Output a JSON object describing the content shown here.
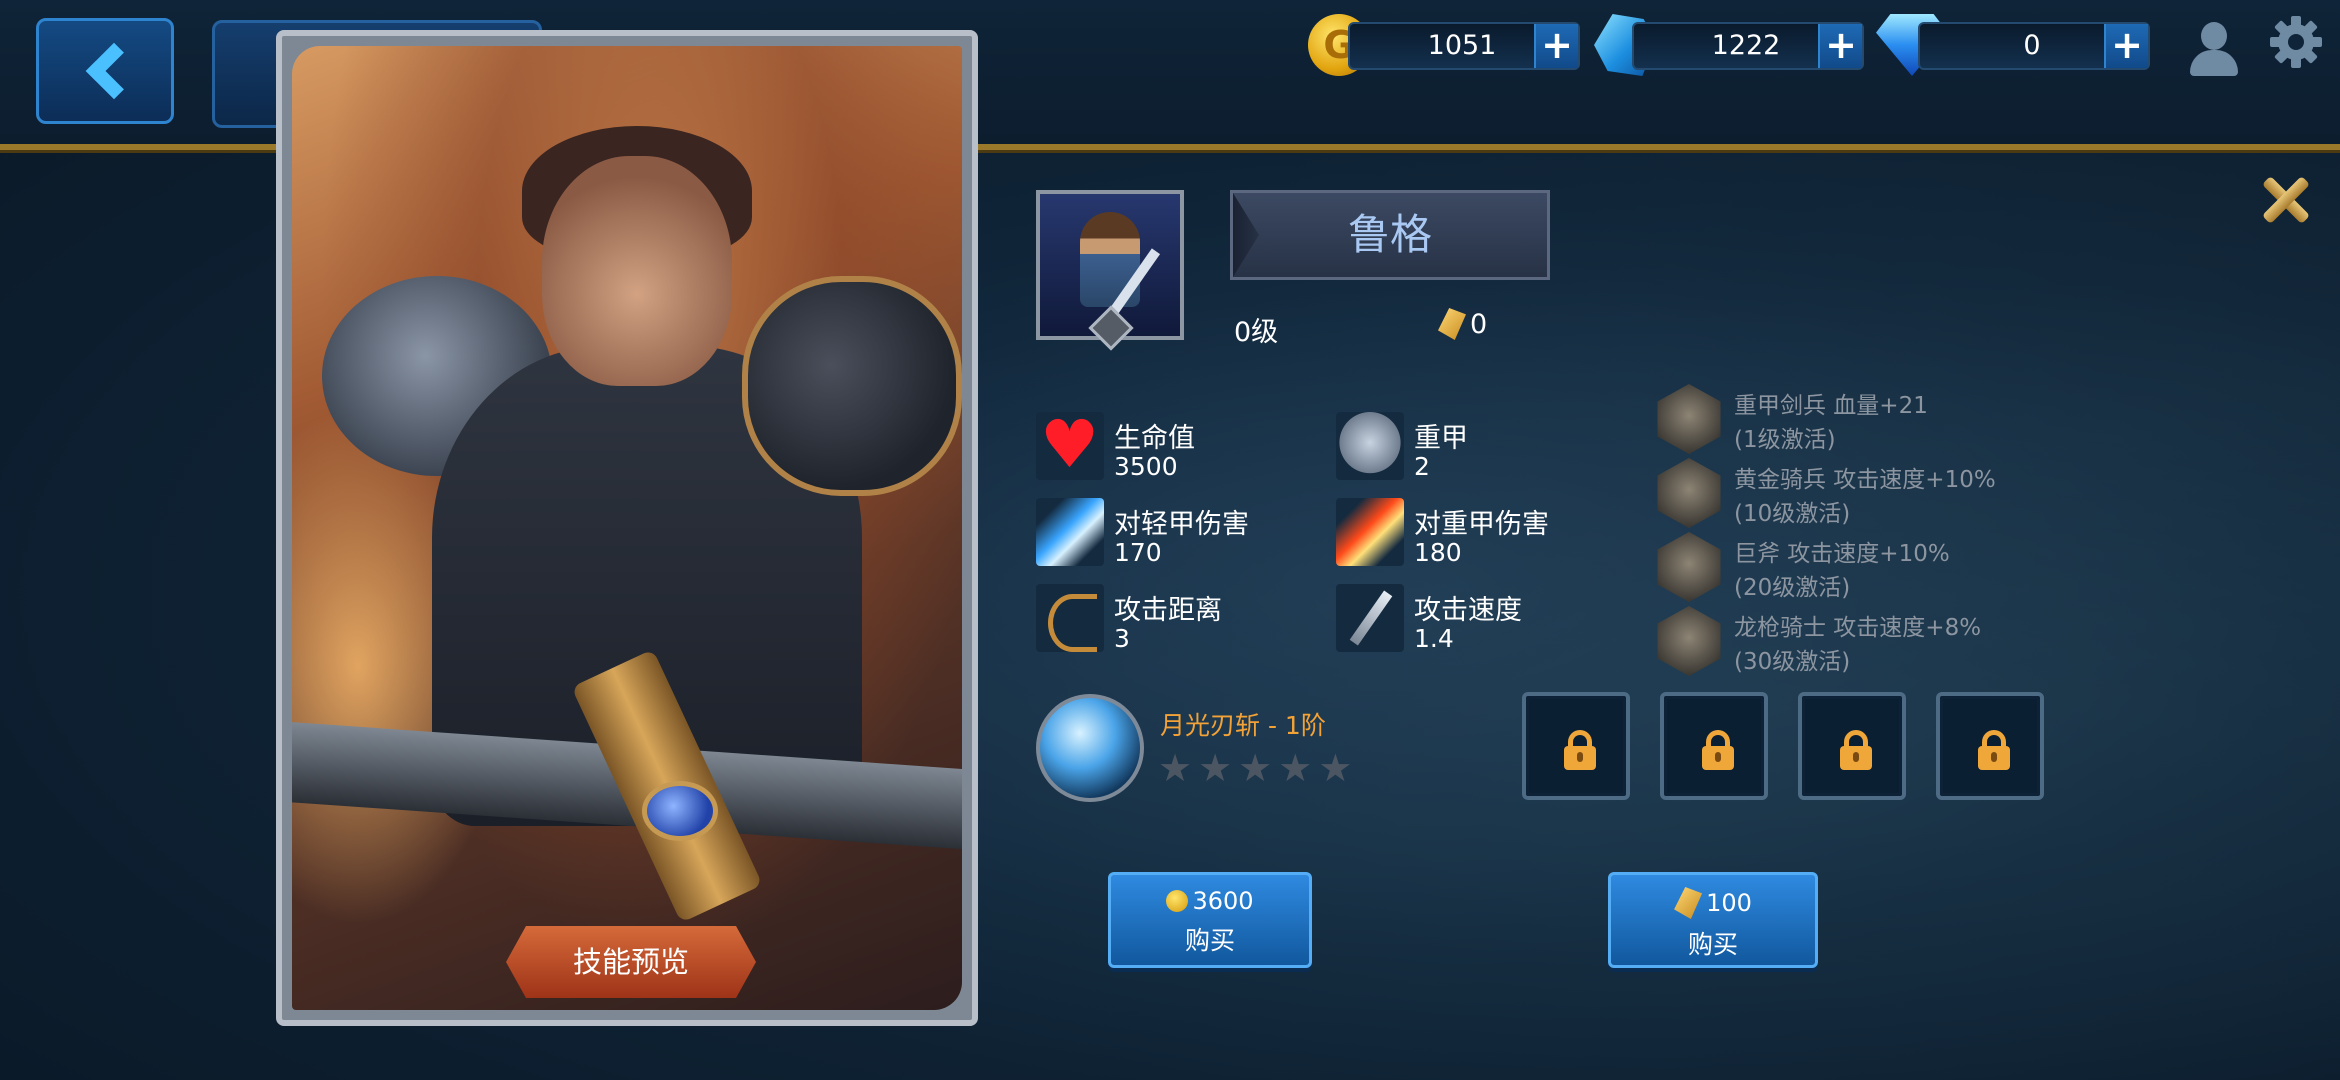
{
  "currency": {
    "gold": "1051",
    "crystal": "1222",
    "diamond": "0",
    "gold_icon_letter": "G",
    "plus": "+"
  },
  "hero": {
    "name": "鲁格",
    "level": "0级",
    "shards": "0",
    "skill_preview": "技能预览"
  },
  "stats": [
    {
      "label": "生命值",
      "value": "3500",
      "icon": "heart-icon"
    },
    {
      "label": "重甲",
      "value": "2",
      "icon": "armor-icon"
    },
    {
      "label": "对轻甲伤害",
      "value": "170",
      "icon": "light-damage-icon"
    },
    {
      "label": "对重甲伤害",
      "value": "180",
      "icon": "heavy-damage-icon"
    },
    {
      "label": "攻击距离",
      "value": "3",
      "icon": "bow-icon"
    },
    {
      "label": "攻击速度",
      "value": "1.4",
      "icon": "dagger-icon"
    }
  ],
  "bonuses": [
    {
      "text": "重甲剑兵 血量+21",
      "condition": "(1级激活)"
    },
    {
      "text": "黄金骑兵 攻击速度+10%",
      "condition": "(10级激活)"
    },
    {
      "text": "巨斧 攻击速度+10%",
      "condition": "(20级激活)"
    },
    {
      "text": "龙枪骑士 攻击速度+8%",
      "condition": "(30级激活)"
    }
  ],
  "skill": {
    "name": "月光刃斩 - 1阶",
    "stars": 0,
    "max_stars": 5
  },
  "buy": {
    "gold_price": "3600",
    "shard_price": "100",
    "label": "购买"
  },
  "colors": {
    "accent_gold": "#9a7a2a",
    "skill_name": "#f2a236",
    "button_blue": "#2f8ae0"
  }
}
